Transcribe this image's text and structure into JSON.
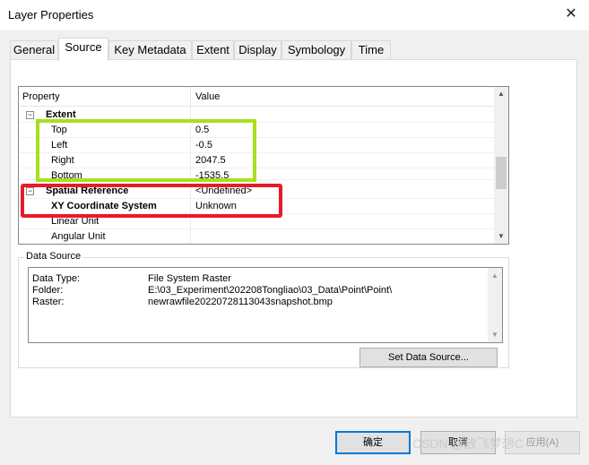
{
  "window": {
    "title": "Layer Properties",
    "close_glyph": "✕"
  },
  "tabs": [
    {
      "label": "General",
      "active": false
    },
    {
      "label": "Source",
      "active": true
    },
    {
      "label": "Key Metadata",
      "active": false
    },
    {
      "label": "Extent",
      "active": false
    },
    {
      "label": "Display",
      "active": false
    },
    {
      "label": "Symbology",
      "active": false
    },
    {
      "label": "Time",
      "active": false
    }
  ],
  "grid": {
    "col_property": "Property",
    "col_value": "Value",
    "rows": [
      {
        "name": "Extent",
        "value": "",
        "bold": true,
        "expander": "−"
      },
      {
        "name": "Top",
        "value": "0.5"
      },
      {
        "name": "Left",
        "value": "-0.5"
      },
      {
        "name": "Right",
        "value": "2047.5"
      },
      {
        "name": "Bottom",
        "value": "-1535.5"
      },
      {
        "name": "Spatial Reference",
        "value": "<Undefined>",
        "bold": true,
        "expander": "−"
      },
      {
        "name": "XY Coordinate System",
        "value": "Unknown",
        "bold": true
      },
      {
        "name": "Linear Unit",
        "value": ""
      },
      {
        "name": "Angular Unit",
        "value": ""
      }
    ]
  },
  "data_source": {
    "label": "Data Source",
    "lines": [
      {
        "label": "Data Type:",
        "value": "File System Raster"
      },
      {
        "label": "Folder:",
        "value": "E:\\03_Experiment\\202208Tongliao\\03_Data\\Point\\Point\\"
      },
      {
        "label": "Raster:",
        "value": "newrawfile20220728113043snapshot.bmp"
      }
    ],
    "set_button": "Set Data Source..."
  },
  "buttons": {
    "ok": "确定",
    "cancel": "取消",
    "apply": "应用(A)"
  },
  "watermark": "CSDN @放飞梦想C"
}
